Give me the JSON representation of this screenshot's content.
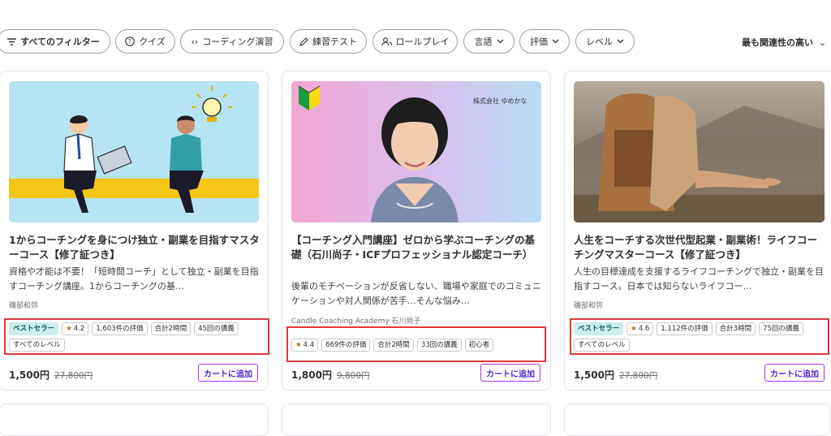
{
  "filters": {
    "all": "すべてのフィルター",
    "quiz": "クイズ",
    "coding": "コーディング演習",
    "practice": "練習テスト",
    "roleplay": "ロールプレイ",
    "language": "言語",
    "rating": "評価",
    "level": "レベル",
    "sort": "最も関連性の高い"
  },
  "colors": {
    "accent": "#a435f0",
    "cart_text": "#5624d0",
    "highlight": "#e0393e",
    "bestseller_bg": "#cdeeea",
    "star": "#b4690e"
  },
  "courses": [
    {
      "title": "1からコーチングを身につけ独立・副業を目指すマスターコース【修了証つき】",
      "description": "資格や才能は不要！「短時間コーチ」として独立・副業を目指すコーチング講座。1からコーチングの基…",
      "instructor": "磯部和弥",
      "bestseller": "ベストセラー",
      "rating": "4.2",
      "reviews": "1,603件の評価",
      "duration": "合計2時間",
      "lectures": "45回の講義",
      "level": "すべてのレベル",
      "price": "1,500円",
      "original_price": "27,800円",
      "cart": "カートに追加"
    },
    {
      "title": "【コーチング入門講座】ゼロから学ぶコーチングの基礎（石川尚子・ICFプロフェッショナル認定コーチ）",
      "description": "後輩のモチベーションが反省しない、職場や家庭でのコミュニケーションや対人関係が苦手…そんな悩み…",
      "instructor": "Candle Coaching Academy 石川尚子",
      "thumb_company": "株式会社 ゆめかな",
      "rating": "4.4",
      "reviews": "669件の評価",
      "duration": "合計2時間",
      "lectures": "33回の講義",
      "level": "初心者",
      "price": "1,800円",
      "original_price": "9,800円",
      "cart": "カートに追加"
    },
    {
      "title": "人生をコーチする次世代型起業・副業術！ライフコーチングマスターコース【修了証つき】",
      "description": "人生の目標達成を支援するライフコーチングで独立・副業を目指すコース。日本では知らないライフコー…",
      "instructor": "磯部和弥",
      "bestseller": "ベストセラー",
      "rating": "4.6",
      "reviews": "1,112件の評価",
      "duration": "合計3時間",
      "lectures": "75回の講義",
      "level": "すべてのレベル",
      "price": "1,500円",
      "original_price": "27,800円",
      "cart": "カートに追加"
    }
  ]
}
